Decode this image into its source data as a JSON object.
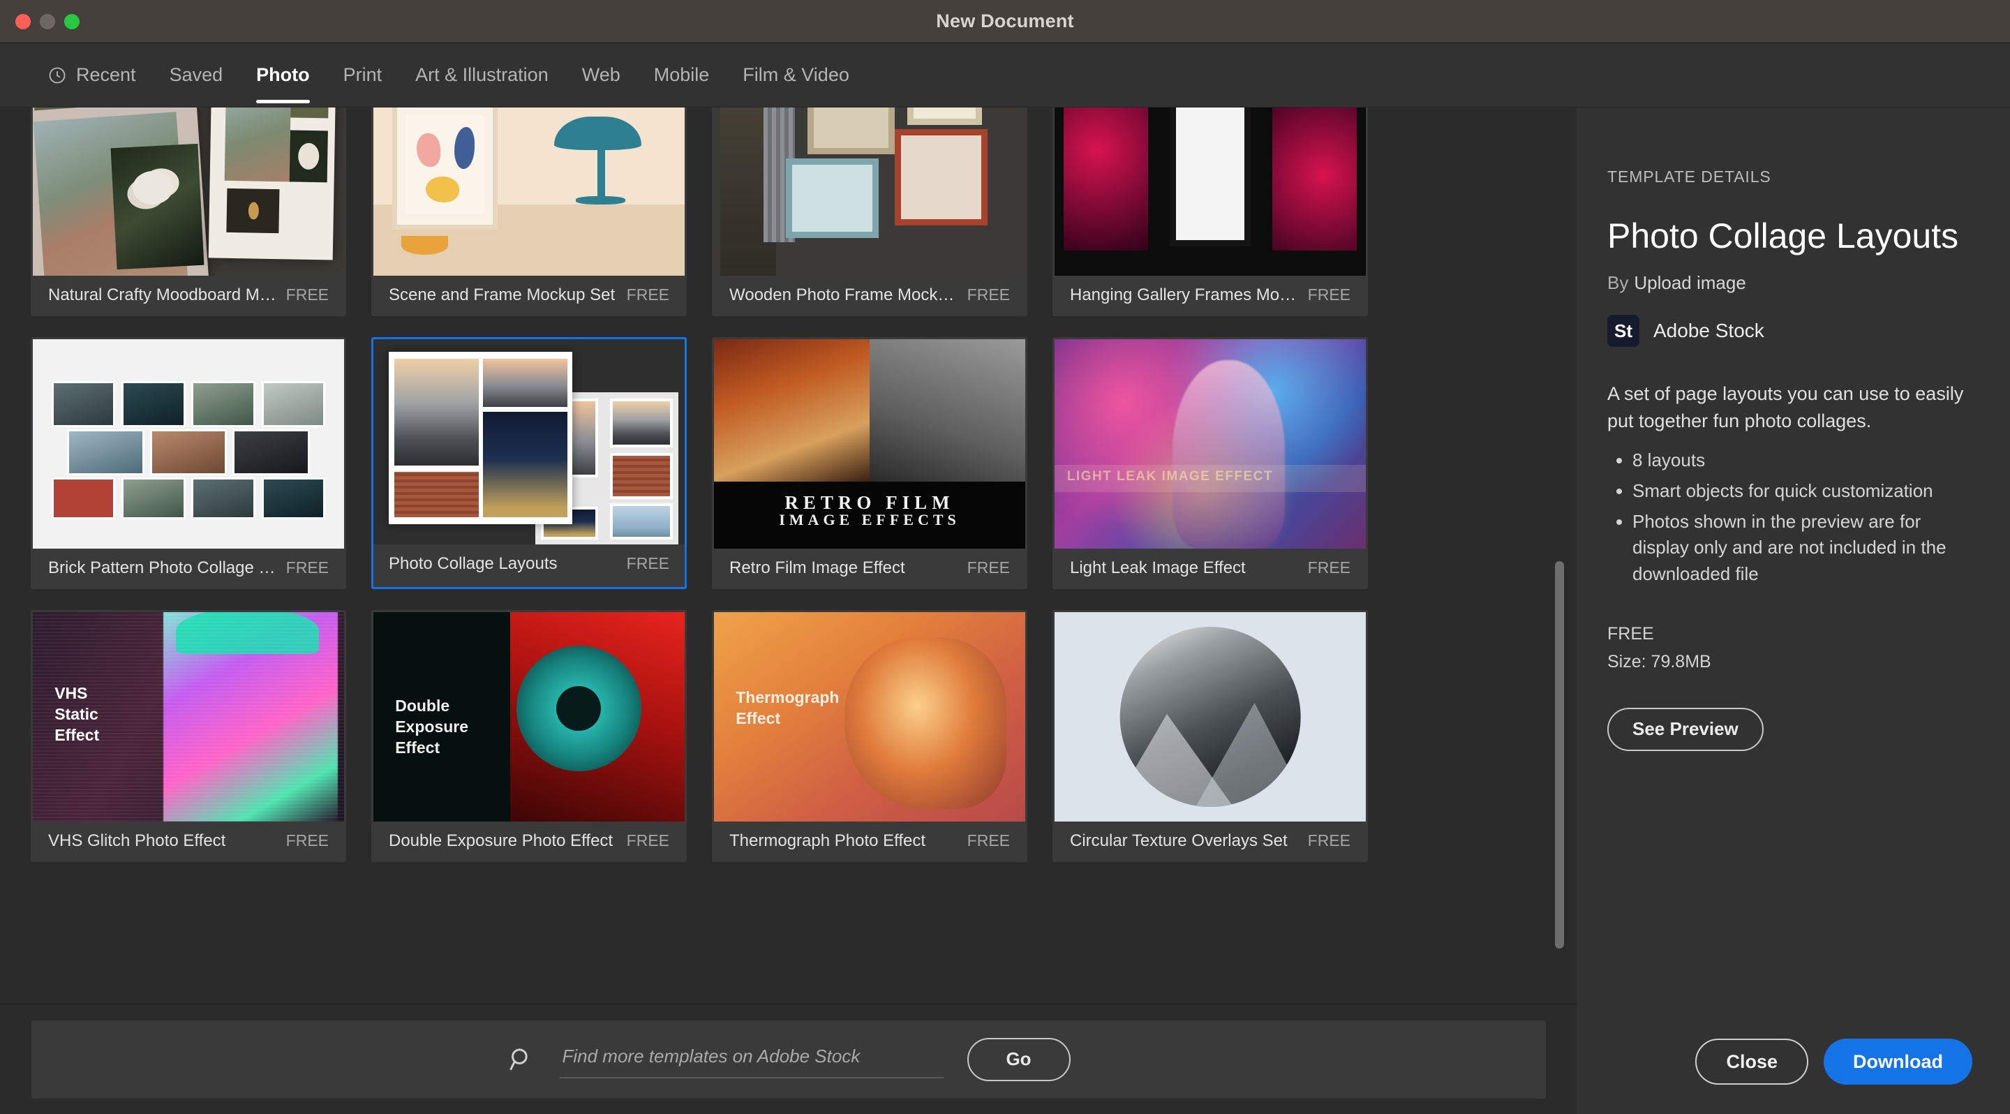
{
  "window": {
    "title": "New Document",
    "traffic_lights": [
      "close",
      "minimize",
      "zoom"
    ]
  },
  "tabs": [
    {
      "label": "Recent",
      "icon": "clock-icon",
      "active": false
    },
    {
      "label": "Saved",
      "active": false
    },
    {
      "label": "Photo",
      "active": true
    },
    {
      "label": "Print",
      "active": false
    },
    {
      "label": "Art & Illustration",
      "active": false
    },
    {
      "label": "Web",
      "active": false
    },
    {
      "label": "Mobile",
      "active": false
    },
    {
      "label": "Film & Video",
      "active": false
    }
  ],
  "templates": [
    {
      "name": "Natural Crafty Moodboard Mockup",
      "price": "FREE",
      "art": "moodboard",
      "selected": false
    },
    {
      "name": "Scene and Frame Mockup Set",
      "price": "FREE",
      "art": "scene-frame",
      "selected": false
    },
    {
      "name": "Wooden Photo Frame Mockup Set",
      "price": "FREE",
      "art": "wooden-frames",
      "selected": false
    },
    {
      "name": "Hanging Gallery Frames Mockups",
      "price": "FREE",
      "art": "hanging-gallery",
      "selected": false
    },
    {
      "name": "Brick Pattern Photo Collage Layo...",
      "price": "FREE",
      "art": "brick-collage",
      "selected": false
    },
    {
      "name": "Photo Collage Layouts",
      "price": "FREE",
      "art": "photo-collage",
      "selected": true
    },
    {
      "name": "Retro Film Image Effect",
      "price": "FREE",
      "art": "retro-film",
      "overlay_line1": "RETRO FILM",
      "overlay_line2": "IMAGE EFFECTS",
      "selected": false
    },
    {
      "name": "Light Leak Image Effect",
      "price": "FREE",
      "art": "light-leak",
      "overlay_line1": "LIGHT LEAK IMAGE EFFECT",
      "selected": false
    },
    {
      "name": "VHS Glitch Photo Effect",
      "price": "FREE",
      "art": "vhs-glitch",
      "overlay_line1": "VHS",
      "overlay_line2": "Static",
      "overlay_line3": "Effect",
      "selected": false
    },
    {
      "name": "Double Exposure Photo Effect",
      "price": "FREE",
      "art": "double-exposure",
      "overlay_line1": "Double",
      "overlay_line2": "Exposure",
      "overlay_line3": "Effect",
      "selected": false
    },
    {
      "name": "Thermograph Photo Effect",
      "price": "FREE",
      "art": "thermograph",
      "overlay_line1": "Thermograph",
      "overlay_line2": "Effect",
      "selected": false
    },
    {
      "name": "Circular Texture Overlays Set",
      "price": "FREE",
      "art": "circular-texture",
      "selected": false
    }
  ],
  "search": {
    "placeholder": "Find more templates on Adobe Stock",
    "value": "",
    "go_label": "Go",
    "icon": "search-icon"
  },
  "details": {
    "section_label": "TEMPLATE DETAILS",
    "title": "Photo Collage Layouts",
    "by_prefix": "By",
    "by_value": "Upload image",
    "provider_badge": "St",
    "provider_name": "Adobe Stock",
    "description": "A set of page layouts you can use to easily put together fun photo collages.",
    "bullets": [
      "8 layouts",
      "Smart objects for quick customization",
      "Photos shown in the preview are for display only and are not included in the downloaded file"
    ],
    "price": "FREE",
    "size_label": "Size:",
    "size_value": "79.8MB",
    "preview_label": "See Preview"
  },
  "footer": {
    "close_label": "Close",
    "download_label": "Download"
  },
  "colors": {
    "accent": "#1473e6",
    "selection_border": "#1473e6",
    "titlebar": "#46403c",
    "panel_bg": "#323232",
    "grid_bg": "#2b2b2b",
    "card_bg": "#3a3a3a"
  }
}
